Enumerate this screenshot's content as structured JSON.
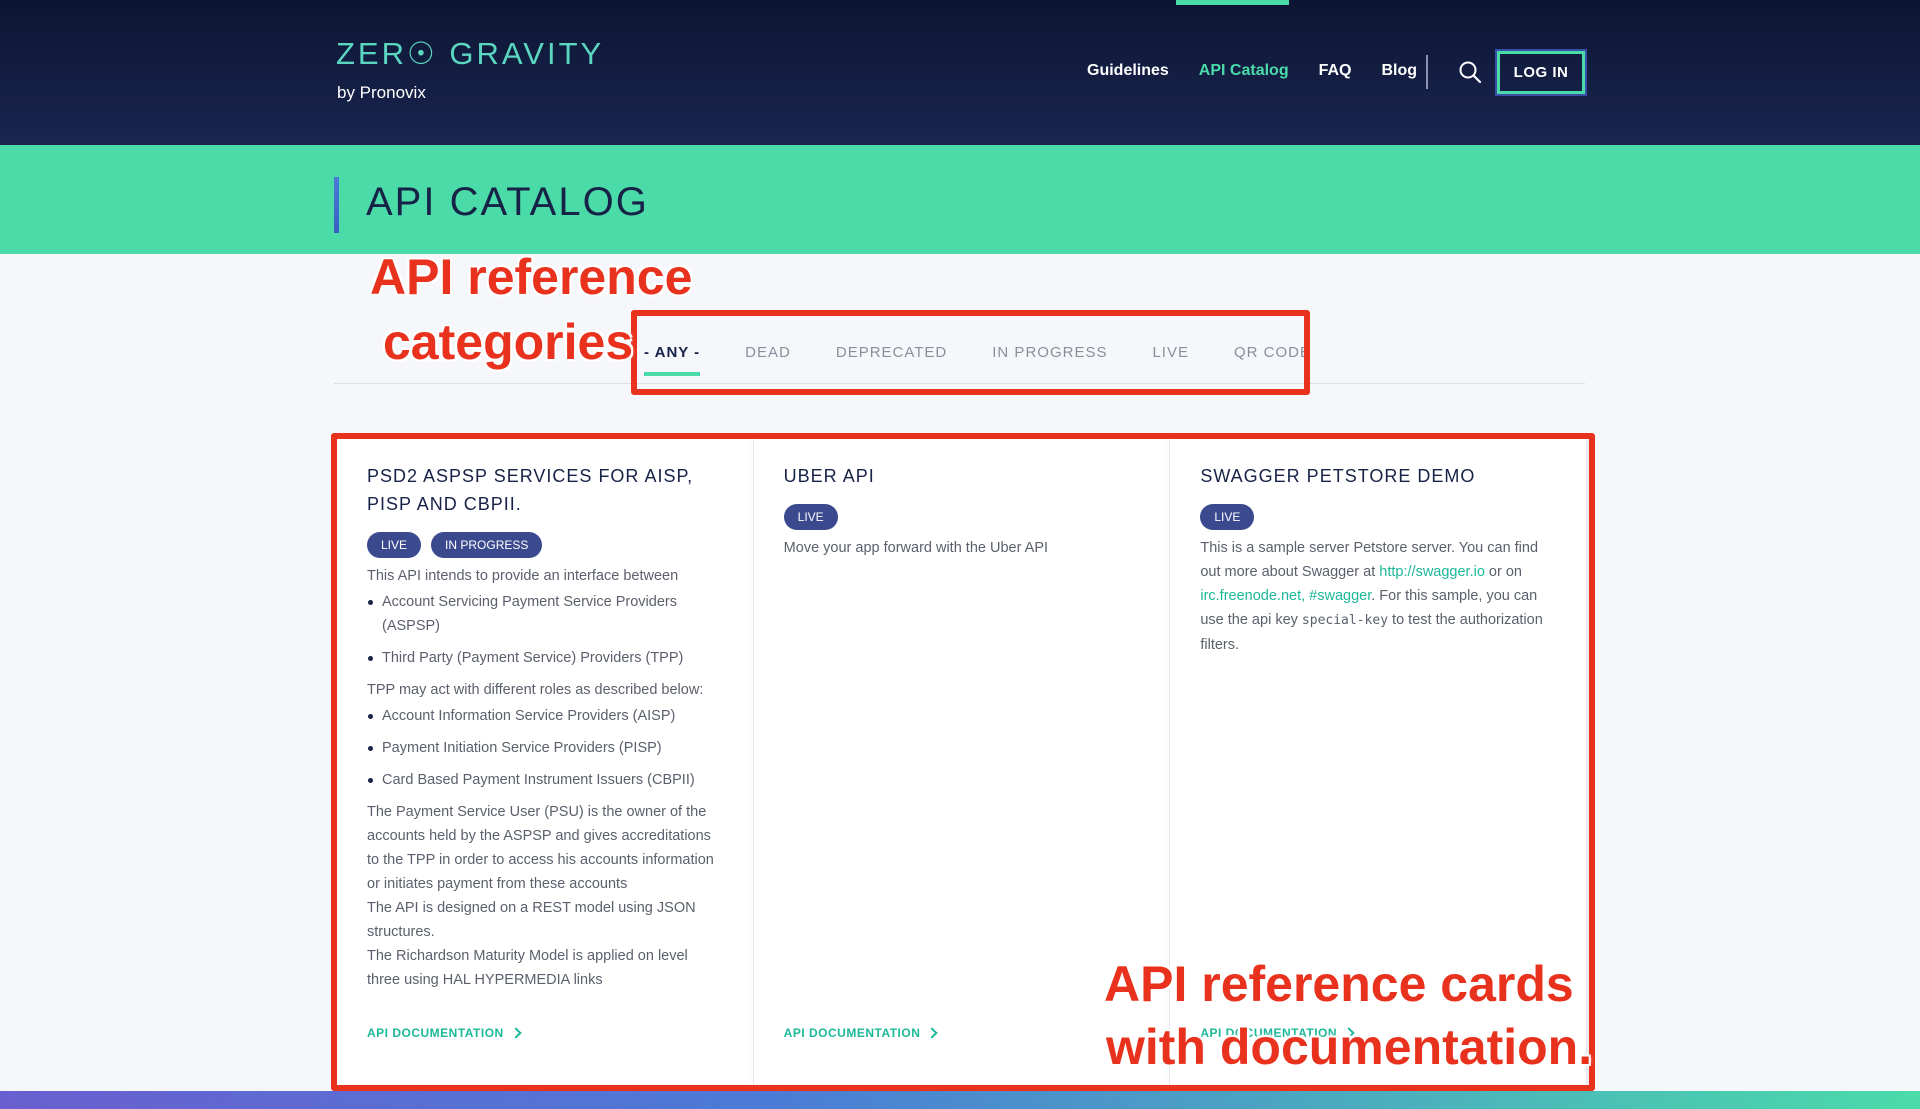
{
  "header": {
    "logo": "ZER☉ GRAVITY",
    "logo_sub": "by Pronovix",
    "nav": [
      {
        "label": "Guidelines",
        "active": false
      },
      {
        "label": "API Catalog",
        "active": true
      },
      {
        "label": "FAQ",
        "active": false
      },
      {
        "label": "Blog",
        "active": false
      }
    ],
    "login_label": "LOG IN",
    "accent_color": "#4bdba9"
  },
  "banner": {
    "title": "API CATALOG"
  },
  "filters": {
    "tabs": [
      "- ANY -",
      "DEAD",
      "DEPRECATED",
      "IN PROGRESS",
      "LIVE",
      "QR CODE"
    ],
    "active": "- ANY -"
  },
  "cards": [
    {
      "title": "PSD2 ASPSP SERVICES FOR AISP, PISP AND CBPII.",
      "badges": [
        "LIVE",
        "IN PROGRESS"
      ],
      "intro": "This API intends to provide an interface between",
      "list1": [
        "Account Servicing Payment Service Providers (ASPSP)",
        "Third Party (Payment Service) Providers (TPP)"
      ],
      "mid": "TPP may act with different roles as described below:",
      "list2": [
        "Account Information Service Providers (AISP)",
        "Payment Initiation Service Providers (PISP)",
        "Card Based Payment Instrument Issuers (CBPII)"
      ],
      "p1": "The Payment Service User (PSU) is the owner of the accounts held by the ASPSP and gives accreditations to the TPP in order to access his accounts information or initiates payment from these accounts",
      "p2": "The API is designed on a REST model using JSON structures.",
      "p3": "The Richardson Maturity Model is applied on level three using HAL HYPERMEDIA links",
      "doc_link": "API DOCUMENTATION"
    },
    {
      "title": "UBER API",
      "badges": [
        "LIVE"
      ],
      "description": "Move your app forward with the Uber API",
      "doc_link": "API DOCUMENTATION"
    },
    {
      "title": "SWAGGER PETSTORE DEMO",
      "badges": [
        "LIVE"
      ],
      "desc_a": "This is a sample server Petstore server. You can find out more about Swagger at ",
      "link1": "http://swagger.io",
      "desc_b": " or on ",
      "link2": "irc.freenode.net, #swagger",
      "desc_c": ". For this sample, you can use the api key ",
      "code": "special-key",
      "desc_d": " to test the authorization filters.",
      "doc_link": "API DOCUMENTATION"
    }
  ],
  "annotations": {
    "categories_line1": "API reference",
    "categories_line2": "categories",
    "cards_line1": "API reference cards",
    "cards_line2": "with documentation.",
    "color": "#e8321e"
  }
}
